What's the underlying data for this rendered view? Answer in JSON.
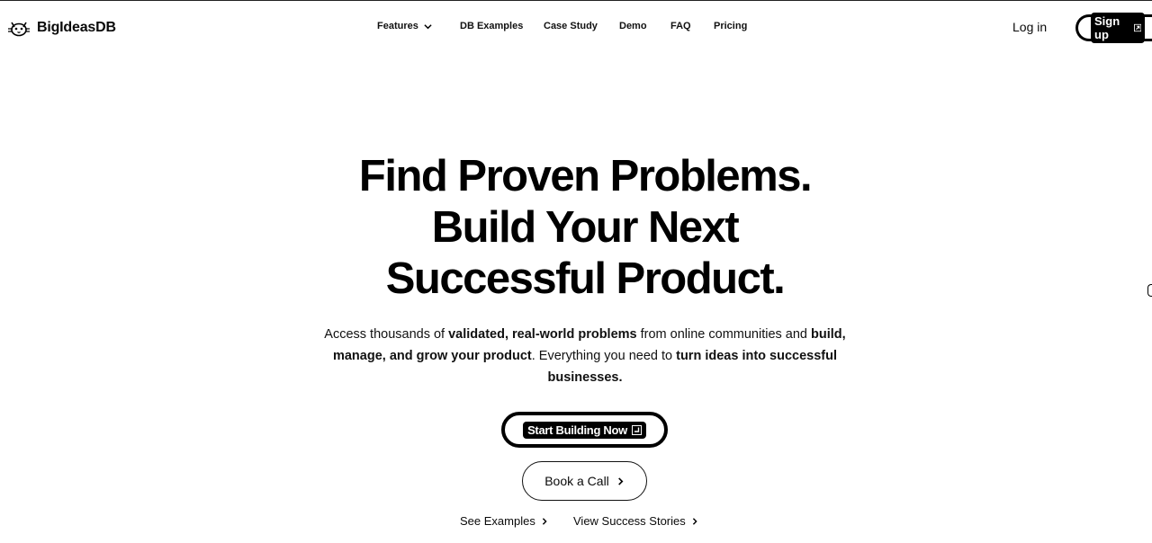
{
  "header": {
    "brand": "BigIdeasDB",
    "logo_icon": "cat-face-icon",
    "nav": [
      {
        "label": "Features",
        "has_dropdown": true
      },
      {
        "label": "DB Examples"
      },
      {
        "label": "Case Study"
      },
      {
        "label": "Demo"
      },
      {
        "label": "FAQ"
      },
      {
        "label": "Pricing"
      }
    ],
    "login_label": "Log in",
    "signup_label": "Sign up",
    "signup_icon": "arrow-up-right-icon"
  },
  "hero": {
    "title_line1": "Find Proven Problems.",
    "title_line2": "Build Your Next",
    "title_line3": "Successful Product.",
    "subtitle": {
      "p1": "Access thousands of ",
      "b1": "validated, real-world problems",
      "p2": " from online communities and ",
      "b2": "build,",
      "b3": "manage, and grow your product",
      "p3": ". Everything you need to ",
      "b4": "turn ideas into successful",
      "b5": "businesses."
    },
    "primary_cta": "Start Building Now",
    "primary_cta_icon": "enter-icon",
    "secondary_cta": "Book a Call",
    "secondary_cta_icon": "chevron-right-icon",
    "link1": "See Examples",
    "link2": "View Success Stories"
  },
  "colors": {
    "text": "#0a0a0a",
    "background": "#ffffff",
    "accent": "#000000"
  }
}
